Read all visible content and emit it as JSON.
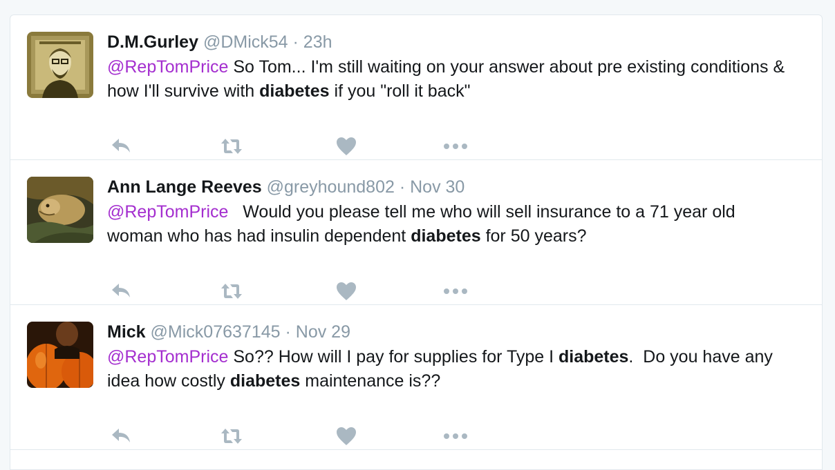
{
  "colors": {
    "mention": "#a42ecf",
    "meta": "#8899a6",
    "icon": "#aab8c2",
    "border": "#e1e8ed"
  },
  "icons": [
    "reply-icon",
    "retweet-icon",
    "like-heart-icon",
    "more-options-icon"
  ],
  "tweets": [
    {
      "fullname": "D.M.Gurley",
      "username": "@DMick54",
      "separator": "·",
      "time": "23h",
      "segments": [
        {
          "type": "mention",
          "text": "@RepTomPrice"
        },
        {
          "type": "text",
          "text": " So Tom... I'm still waiting on your answer about pre existing conditions & how I'll survive with "
        },
        {
          "type": "keyword",
          "text": "diabetes"
        },
        {
          "type": "text",
          "text": " if you \"roll it back\""
        }
      ]
    },
    {
      "fullname": "Ann Lange Reeves",
      "username": "@greyhound802",
      "separator": "·",
      "time": "Nov 30",
      "segments": [
        {
          "type": "mention",
          "text": "@RepTomPrice"
        },
        {
          "type": "text",
          "text": "   Would you please tell me who will sell insurance to a 71 year old woman who has had insulin dependent "
        },
        {
          "type": "keyword",
          "text": "diabetes"
        },
        {
          "type": "text",
          "text": " for 50 years?"
        }
      ]
    },
    {
      "fullname": "Mick",
      "username": "@Mick07637145",
      "separator": "·",
      "time": "Nov 29",
      "segments": [
        {
          "type": "mention",
          "text": "@RepTomPrice"
        },
        {
          "type": "text",
          "text": " So?? How will I pay for supplies for Type I "
        },
        {
          "type": "keyword",
          "text": "diabetes"
        },
        {
          "type": "text",
          "text": ".  Do you have any idea how costly "
        },
        {
          "type": "keyword",
          "text": "diabetes"
        },
        {
          "type": "text",
          "text": " maintenance is??"
        }
      ]
    }
  ]
}
